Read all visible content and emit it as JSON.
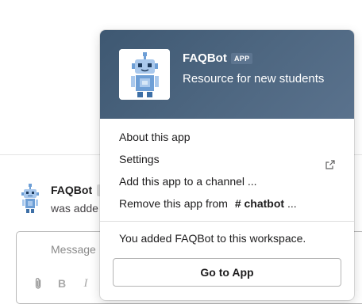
{
  "background": {
    "message": {
      "sender": "FAQBot",
      "text": "was adde"
    },
    "composer": {
      "placeholder": "Message",
      "toolbar": {
        "bold": "B",
        "italic": "I"
      }
    }
  },
  "popover": {
    "app_name": "FAQBot",
    "badge": "APP",
    "description": "Resource for new students",
    "menu": {
      "about": "About this app",
      "settings": "Settings",
      "add_to_channel": "Add this app to a channel ...",
      "remove_prefix": "Remove this app from",
      "remove_channel": "# chatbot",
      "remove_suffix": " ..."
    },
    "added_note": "You added FAQBot to this workspace.",
    "go_button": "Go to App"
  },
  "icons": {
    "bot_avatar": "robot-icon",
    "settings_external": "external-link-icon",
    "attach": "paperclip-icon"
  },
  "colors": {
    "header_bg": "#4a637d",
    "robot_light": "#a9c8ec",
    "robot_mid": "#6e9fd6",
    "robot_dark": "#3d6fa6"
  }
}
